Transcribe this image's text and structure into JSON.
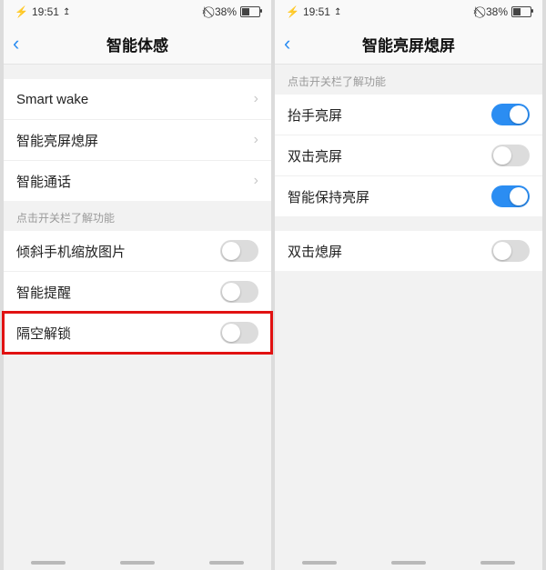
{
  "status": {
    "time": "19:51",
    "battery_text": "38%"
  },
  "left": {
    "title": "智能体感",
    "nav_rows": [
      {
        "label": "Smart wake"
      },
      {
        "label": "智能亮屏熄屏"
      },
      {
        "label": "智能通话"
      }
    ],
    "section_hint": "点击开关栏了解功能",
    "toggle_rows": [
      {
        "label": "倾斜手机缩放图片",
        "on": false
      },
      {
        "label": "智能提醒",
        "on": false
      },
      {
        "label": "隔空解锁",
        "on": false
      }
    ],
    "highlight_row_index": 2
  },
  "right": {
    "title": "智能亮屏熄屏",
    "section_hint": "点击开关栏了解功能",
    "group1": [
      {
        "label": "抬手亮屏",
        "on": true
      },
      {
        "label": "双击亮屏",
        "on": false
      },
      {
        "label": "智能保持亮屏",
        "on": true
      }
    ],
    "group2": [
      {
        "label": "双击熄屏",
        "on": false
      }
    ]
  }
}
